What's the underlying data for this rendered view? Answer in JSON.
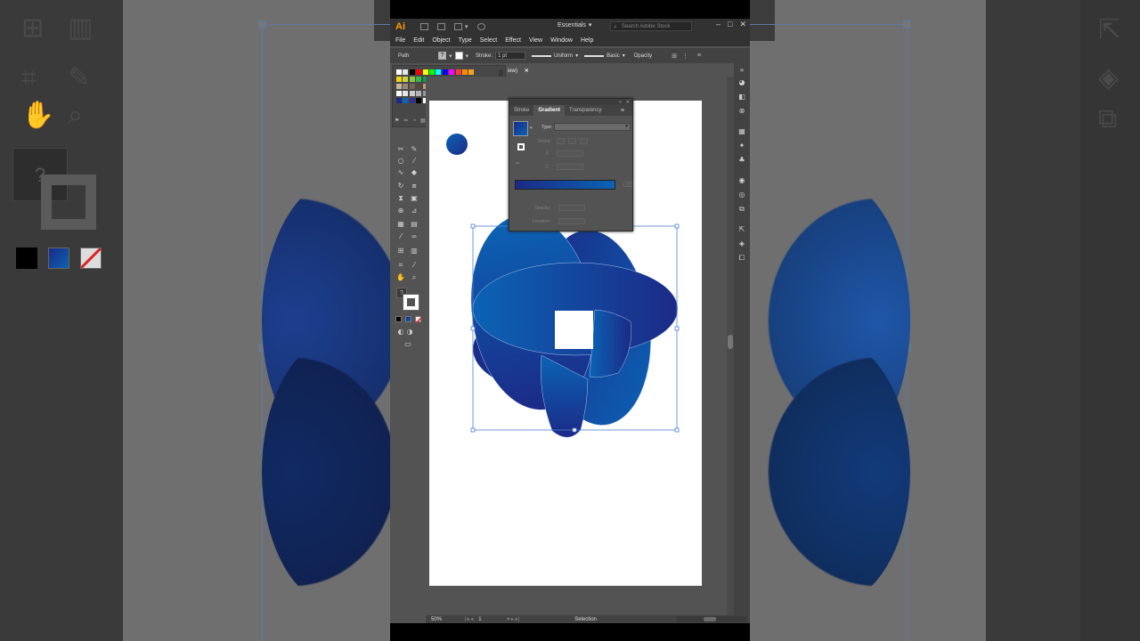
{
  "app": {
    "logo": "Ai",
    "workspace": "Essentials",
    "stock_search_placeholder": "Search Adobe Stock",
    "window_buttons": [
      "–",
      "□",
      "✕"
    ]
  },
  "menu": [
    "File",
    "Edit",
    "Object",
    "Type",
    "Select",
    "Effect",
    "View",
    "Window",
    "Help"
  ],
  "control_bar": {
    "selection_type": "Path",
    "stroke_label": "Stroke:",
    "stroke_weight": "1 pt",
    "profile": "Uniform",
    "brush": "Basic",
    "opacity_label": "Opacity"
  },
  "document_tab": {
    "label": "iew)",
    "close": "✕"
  },
  "gradient_panel": {
    "tabs": [
      "Stroke",
      "Gradient",
      "Transparency"
    ],
    "active_tab": "Gradient",
    "type_label": "Type:",
    "stroke_label": "Stroke:",
    "opacity_label": "Opacity:",
    "location_label": "Location:",
    "start_color": "#1b2a86",
    "end_color": "#0b63b5"
  },
  "status_bar": {
    "zoom": "50%",
    "artboard_number": "1",
    "mode": "Selection"
  },
  "colors": {
    "gradient_dark": "#1b2a86",
    "gradient_light": "#0b63b5",
    "selection_blue": "#4a7fd0"
  }
}
